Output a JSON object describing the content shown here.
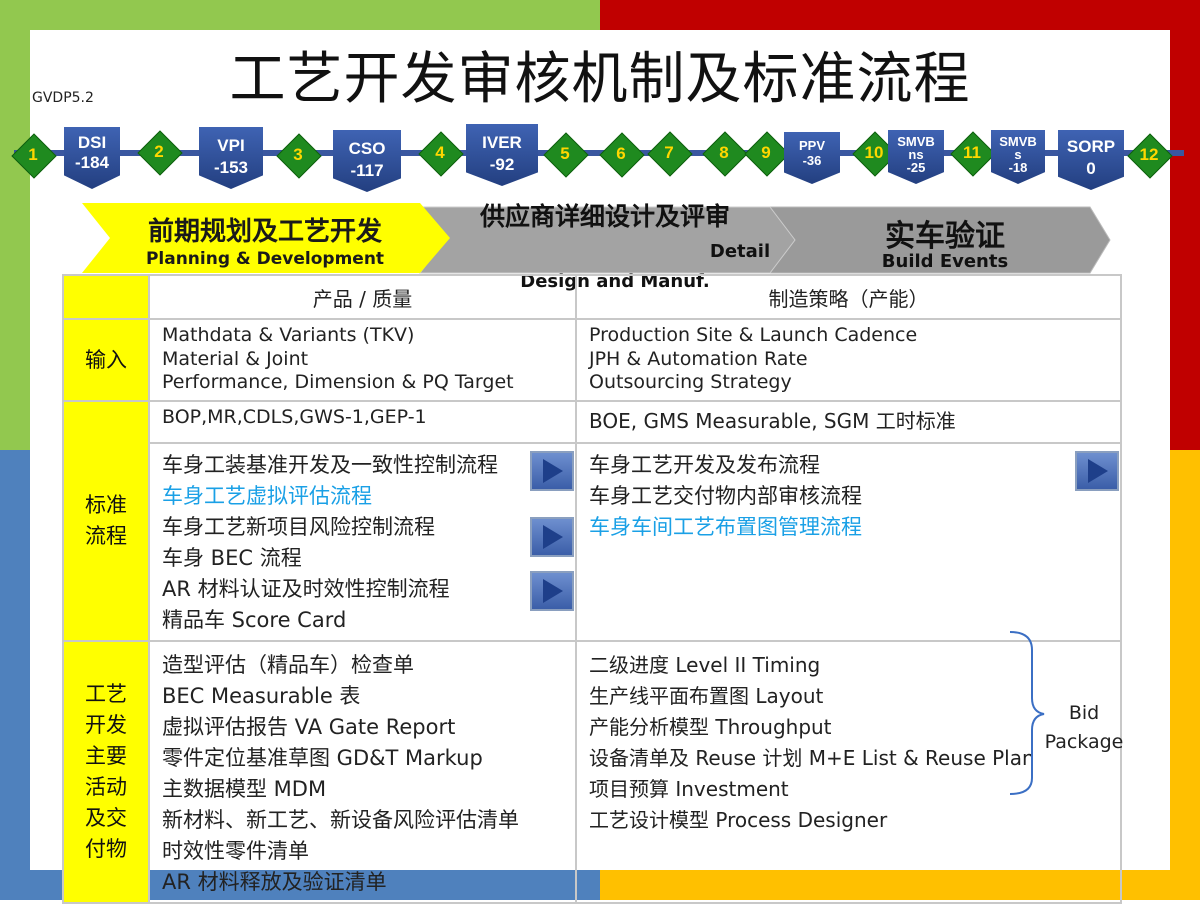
{
  "title": "工艺开发审核机制及标准流程",
  "version": "GVDP5.2",
  "timeline": {
    "diamonds": [
      "1",
      "2",
      "3",
      "4",
      "5",
      "6",
      "7",
      "8",
      "9",
      "10",
      "11",
      "12"
    ],
    "gates": [
      {
        "name": "DSI",
        "value": "-184"
      },
      {
        "name": "VPI",
        "value": "-153"
      },
      {
        "name": "CSO",
        "value": "-117"
      },
      {
        "name": "IVER",
        "value": "-92"
      },
      {
        "name": "PPV",
        "value": "-36"
      },
      {
        "name": "SMVB",
        "name2": "ns",
        "value": "-25"
      },
      {
        "name": "SMVB",
        "name2": "s",
        "value": "-18"
      },
      {
        "name": "SORP",
        "value": "0"
      }
    ]
  },
  "phases": {
    "p1_zh": "前期规划及工艺开发",
    "p1_en": "Planning & Development",
    "p2_zh": "供应商详细设计及评审",
    "p2_en1": "Detail",
    "p2_en2": "Design and Manuf.",
    "p3_zh": "实车验证",
    "p3_en": "Build Events"
  },
  "table": {
    "col1": "产品 / 质量",
    "col2": "制造策略（产能）",
    "input": {
      "label": "输入",
      "left": [
        "Mathdata & Variants (TKV)",
        "Material  & Joint",
        "Performance, Dimension & PQ Target"
      ],
      "right": [
        "Production Site & Launch Cadence",
        "JPH & Automation Rate",
        "Outsourcing Strategy"
      ]
    },
    "standard": {
      "label1": "标准",
      "label2": "流程",
      "left_top": "BOP,MR,CDLS,GWS-1,GEP-1",
      "right_top": "BOE, GMS Measurable, SGM 工时标准",
      "left": [
        "车身工装基准开发及一致性控制流程",
        "车身工艺虚拟评估流程",
        "车身工艺新项目风险控制流程",
        "车身 BEC 流程",
        "AR 材料认证及时效性控制流程",
        "精品车 Score Card"
      ],
      "right": [
        "车身工艺开发及发布流程",
        "车身工艺交付物内部审核流程",
        "车身车间工艺布置图管理流程"
      ]
    },
    "activities": {
      "label": [
        "工艺",
        "开发",
        "主要",
        "活动",
        "及交",
        "付物"
      ],
      "left": [
        "造型评估（精品车）检查单",
        "BEC Measurable 表",
        "虚拟评估报告 VA Gate Report",
        "零件定位基准草图 GD&T Markup",
        "主数据模型 MDM",
        "新材料、新工艺、新设备风险评估清单",
        "时效性零件清单",
        "AR 材料释放及验证清单"
      ],
      "right": [
        "二级进度  Level II Timing",
        "生产线平面布置图 Layout",
        "产能分析模型 Throughput",
        "设备清单及 Reuse 计划 M+E List & Reuse Plan",
        "项目预算 Investment",
        "工艺设计模型   Process Designer"
      ]
    }
  },
  "bid": {
    "line1": "Bid",
    "line2": "Package"
  },
  "colors": {
    "green": "#92c84f",
    "red": "#c00000",
    "blue": "#4f81bd",
    "orange": "#ffc000",
    "link": "#1aa0e6",
    "yellow": "#ffff00"
  }
}
